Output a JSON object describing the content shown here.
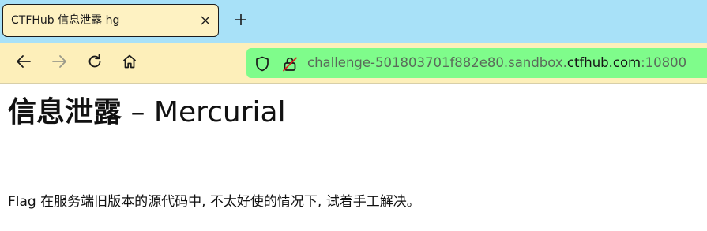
{
  "browser": {
    "tab": {
      "title": "CTFHub 信息泄露 hg",
      "close_icon": "close-icon"
    },
    "new_tab_icon": "plus-icon",
    "nav": {
      "back_icon": "arrow-left-icon",
      "forward_icon": "arrow-right-icon",
      "reload_icon": "reload-icon",
      "home_icon": "home-icon"
    },
    "urlbar": {
      "shield_icon": "shield-icon",
      "insecure_lock_icon": "insecure-lock-icon",
      "url_subdomain": "challenge-501803701f882e80.sandbox.",
      "url_domain": "ctfhub.com",
      "url_port": ":10800"
    },
    "colors": {
      "tabbar": "#a8e1f8",
      "tab": "#fef2c2",
      "toolbar": "#fdefba",
      "urlbar": "#7ffc8b"
    }
  },
  "page": {
    "heading_cn": "信息泄露",
    "heading_rest": " – Mercurial",
    "description": "Flag 在服务端旧版本的源代码中, 不太好使的情况下, 试着手工解决。"
  }
}
